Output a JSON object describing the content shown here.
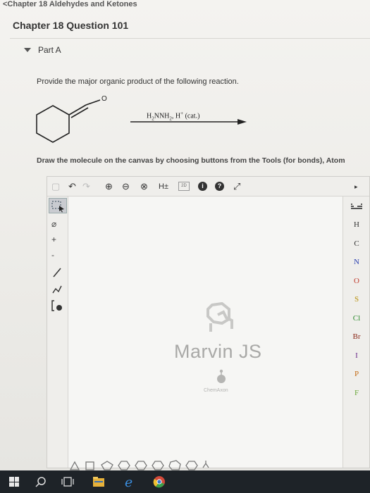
{
  "header": {
    "breadcrumb": "<Chapter 18 Aldehydes and Ketones",
    "question_title": "Chapter 18 Question 101"
  },
  "part": {
    "label": "Part A",
    "prompt": "Provide the major organic product of the following reaction."
  },
  "reaction": {
    "carbonyl_atom": "O",
    "reagent_main": "H",
    "reagent_sub1": "2",
    "reagent_mid": "NNH",
    "reagent_sub2": "2",
    "reagent_sep": ", H",
    "reagent_sup": "+",
    "reagent_end": " (cat.)"
  },
  "instructions": "Draw the molecule on the canvas by choosing buttons from the Tools (for bonds), Atom",
  "editor": {
    "top_tools": {
      "hydrogen_toggle": "H±",
      "mode_2d": "2D",
      "info": "i",
      "help": "?"
    },
    "left_tools": {
      "plus": "+",
      "minus": "-"
    },
    "atoms": [
      "H",
      "C",
      "N",
      "O",
      "S",
      "Cl",
      "Br",
      "I",
      "P",
      "F"
    ],
    "atom_colors": {
      "H": "#333333",
      "C": "#333333",
      "N": "#2a3fb0",
      "O": "#c0392b",
      "S": "#b8900c",
      "Cl": "#2e8b2e",
      "Br": "#8b2a1a",
      "I": "#6a2a8a",
      "P": "#c46a12",
      "F": "#6aa83a"
    },
    "watermark": {
      "brand": "Marvin JS",
      "vendor": "ChemAxon"
    }
  },
  "taskbar": {
    "icons": [
      "windows-start-icon",
      "search-icon",
      "task-view-icon",
      "file-explorer-icon",
      "edge-icon",
      "chrome-icon"
    ]
  }
}
